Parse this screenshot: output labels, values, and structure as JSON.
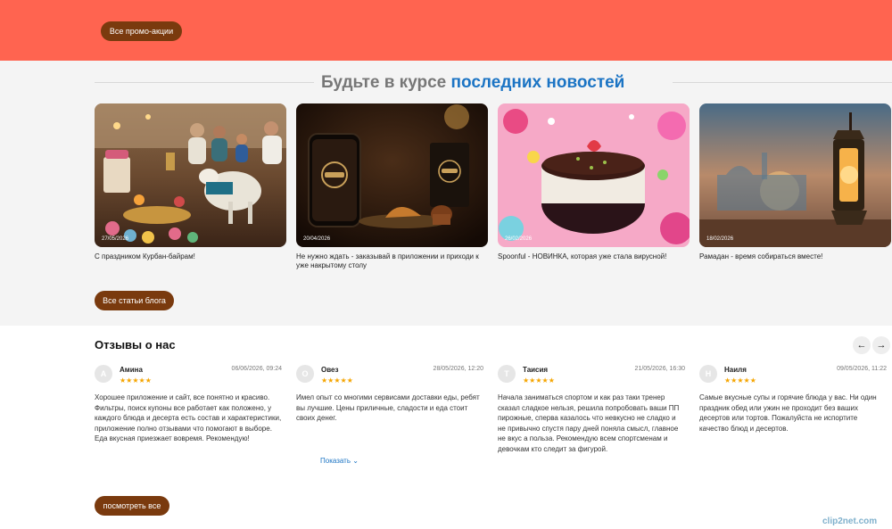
{
  "promo": {
    "button_label": "Все промо-акции"
  },
  "news": {
    "heading_part1": "Будьте в курсе",
    "heading_part2": "последних новостей",
    "cards": [
      {
        "date": "27/05/2026",
        "caption": "С праздником Курбан-байрам!"
      },
      {
        "date": "20/04/2026",
        "caption": "Не нужно ждать - заказывай в приложении и приходи к уже накрытому столу"
      },
      {
        "date": "26/02/2026",
        "caption": "Spoonful - НОВИНКА, которая уже стала вирусной!"
      },
      {
        "date": "18/02/2026",
        "caption": "Рамадан - время собираться вместе!"
      }
    ],
    "all_posts_label": "Все статьи блога"
  },
  "reviews": {
    "title": "Отзывы о нас",
    "prev_glyph": "←",
    "next_glyph": "→",
    "items": [
      {
        "initial": "А",
        "name": "Амина",
        "stars": "★★★★★",
        "date": "06/06/2026, 09:24",
        "text": "Хорошее приложение и сайт, все понятно и красиво. Фильтры, поиск купоны все работает как положено, у каждого блюда и десерта есть состав и характеристики, приложение полно отзывами что помогают в выборе. Еда вкусная приезжает вовремя. Рекомендую!"
      },
      {
        "initial": "О",
        "name": "Овез",
        "stars": "★★★★★",
        "date": "28/05/2026, 12:20",
        "text": "Имел опыт со многими сервисами доставки еды, ребят вы лучшие. Цены приличные, сладости и еда стоит своих денег.",
        "more": "Показать ⌄"
      },
      {
        "initial": "Т",
        "name": "Таисия",
        "stars": "★★★★★",
        "date": "21/05/2026, 16:30",
        "text": "Начала заниматься спортом и как раз таки тренер сказал сладкое нельзя, решила попробовать ваши ПП пирожные, сперва казалось что невкусно не сладко и не привычно спустя пару дней поняла смысл, главное не вкус а польза. Рекомендую всем спортсменам и девочкам кто следит за фигурой."
      },
      {
        "initial": "Н",
        "name": "Наиля",
        "stars": "★★★★★",
        "date": "09/05/2026, 11:22",
        "text": "Самые вкусные супы и горячие блюда у вас. Ни один праздник обед или ужин не проходит без ваших десертов или тортов. Пожалуйста не испортите качество блюд и десертов."
      }
    ],
    "all_label": "посмотреть все"
  },
  "watermark": "clip2net.com"
}
